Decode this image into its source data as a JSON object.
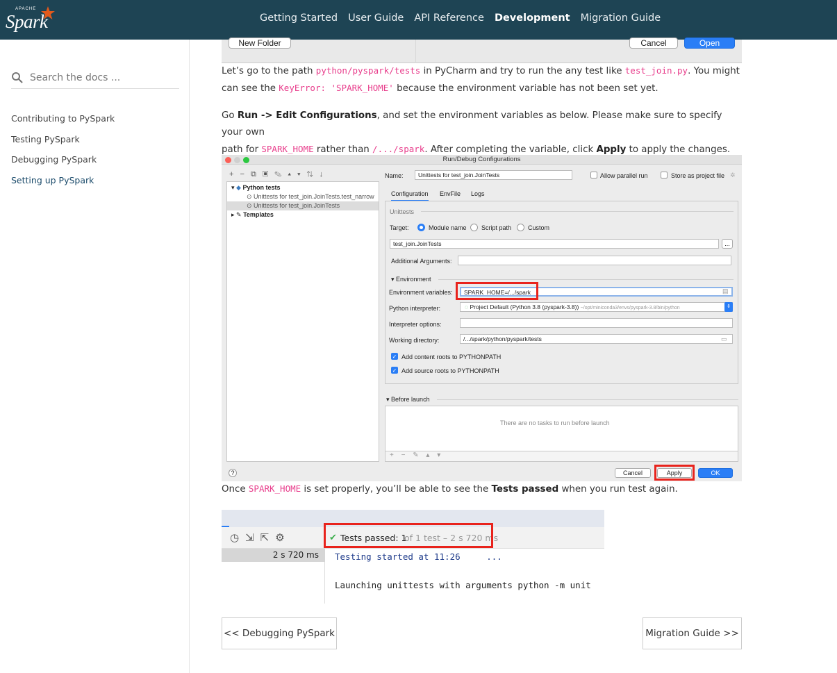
{
  "header": {
    "logo_small": "APACHE",
    "logo_text": "Spark",
    "nav": [
      "Getting Started",
      "User Guide",
      "API Reference",
      "Development",
      "Migration Guide"
    ],
    "active_nav": "Development"
  },
  "sidebar": {
    "search_placeholder": "Search the docs ...",
    "items": [
      "Contributing to PySpark",
      "Testing PySpark",
      "Debugging PySpark",
      "Setting up PySpark"
    ],
    "active_item": "Setting up PySpark"
  },
  "top_shot": {
    "new_folder": "New Folder",
    "cancel": "Cancel",
    "open": "Open"
  },
  "para1": {
    "t1": "Let’s go to the path ",
    "c1": "python/pyspark/tests",
    "t2": " in PyCharm and try to run the any test like ",
    "c2": "test_join.py",
    "t3": ". You might",
    "t4": "can see the ",
    "c3": "KeyError: 'SPARK_HOME'",
    "t5": " because the environment variable has not been set yet."
  },
  "para2": {
    "t1": "Go ",
    "b1": "Run -> Edit Configurations",
    "t2": ", and set the environment variables as below. Please make sure to specify your own",
    "t3": "path for ",
    "c1": "SPARK_HOME",
    "t4": " rather than ",
    "c2": "/.../spark",
    "t5": ". After completing the variable, click ",
    "b2": "Apply",
    "t6": " to apply the changes."
  },
  "dialog": {
    "title": "Run/Debug Configurations",
    "tree_python_tests": "Python tests",
    "tree_item1": "Unittests for test_join.JoinTests.test_narrow",
    "tree_item2": "Unittests for test_join.JoinTests",
    "tree_templates": "Templates",
    "name_label": "Name:",
    "name_value": "Unittests for test_join.JoinTests",
    "allow_parallel": "Allow parallel run",
    "store_project": "Store as project file",
    "tabs": [
      "Configuration",
      "EnvFile",
      "Logs"
    ],
    "section_unittests": "Unittests",
    "target_label": "Target:",
    "target_options": [
      "Module name",
      "Script path",
      "Custom"
    ],
    "target_value": "test_join.JoinTests",
    "additional_args": "Additional Arguments:",
    "environment": "Environment",
    "env_vars_label": "Environment variables:",
    "env_vars_value": "SPARK_HOME=/.../spark",
    "python_interp_label": "Python interpreter:",
    "python_interp_value": "Project Default (Python 3.8 (pyspark-3.8))",
    "python_interp_path": "~/opt/miniconda3/envs/pyspark-3.8/bin/python",
    "interp_options_label": "Interpreter options:",
    "working_dir_label": "Working directory:",
    "working_dir_value": "/.../spark/python/pyspark/tests",
    "add_content_roots": "Add content roots to PYTHONPATH",
    "add_source_roots": "Add source roots to PYTHONPATH",
    "before_launch": "Before launch",
    "no_tasks": "There are no tasks to run before launch",
    "browse": "...",
    "help": "?",
    "cancel": "Cancel",
    "apply": "Apply",
    "ok": "OK"
  },
  "para3": {
    "t1": "Once ",
    "c1": "SPARK_HOME",
    "t2": " is set properly, you’ll be able to see the ",
    "b1": "Tests passed",
    "t3": " when you run test again."
  },
  "test_shot": {
    "passed_label": "Tests passed: 1",
    "passed_detail": "of 1 test – 2 s 720 ms",
    "duration": "2 s 720 ms",
    "line1": "Testing started at 11:26     ...",
    "line2": "Launching unittests with arguments python -m unit"
  },
  "pager": {
    "prev": "<< Debugging PySpark",
    "next": "Migration Guide >>"
  },
  "colors": {
    "header_bg": "#1e4454",
    "code": "#e83e8c",
    "highlight": "#e8231c",
    "accent": "#2a7ef6"
  }
}
